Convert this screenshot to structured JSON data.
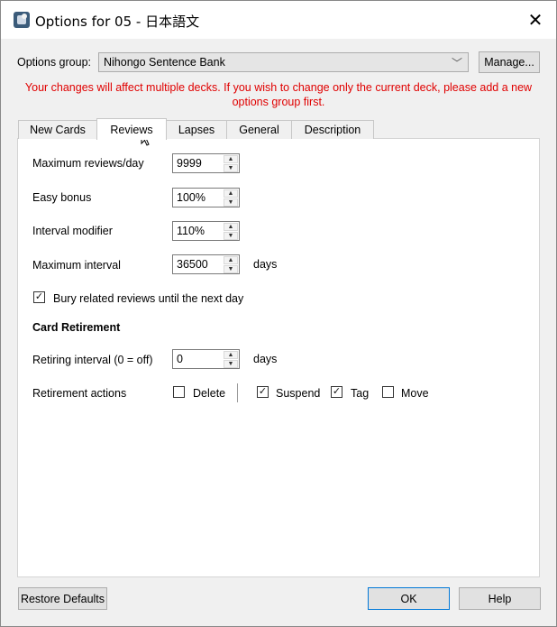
{
  "window": {
    "title": "Options for 05 - 日本語文"
  },
  "options_group": {
    "label": "Options group:",
    "selected": "Nihongo Sentence Bank",
    "manage_label": "Manage..."
  },
  "warning": "Your changes will affect multiple decks. If you wish to change only the current deck, please add a new options group first.",
  "tabs": [
    {
      "label": "New Cards"
    },
    {
      "label": "Reviews"
    },
    {
      "label": "Lapses"
    },
    {
      "label": "General"
    },
    {
      "label": "Description"
    }
  ],
  "reviews": {
    "max_reviews": {
      "label": "Maximum reviews/day",
      "value": "9999"
    },
    "easy_bonus": {
      "label": "Easy bonus",
      "value": "100%"
    },
    "interval_modifier": {
      "label": "Interval modifier",
      "value": "110%"
    },
    "max_interval": {
      "label": "Maximum interval",
      "value": "36500",
      "unit": "days"
    },
    "bury": {
      "label": "Bury related reviews until the next day",
      "checked": true
    }
  },
  "retirement": {
    "heading": "Card Retirement",
    "interval": {
      "label": "Retiring interval (0 = off)",
      "value": "0",
      "unit": "days"
    },
    "actions_label": "Retirement actions",
    "actions": [
      {
        "label": "Delete",
        "checked": false
      },
      {
        "label": "Suspend",
        "checked": true
      },
      {
        "label": "Tag",
        "checked": true
      },
      {
        "label": "Move",
        "checked": false
      }
    ]
  },
  "buttons": {
    "restore_defaults": "Restore Defaults",
    "ok": "OK",
    "help": "Help"
  },
  "colors": {
    "warning": "#e00000",
    "ok_border": "#0078d7"
  }
}
